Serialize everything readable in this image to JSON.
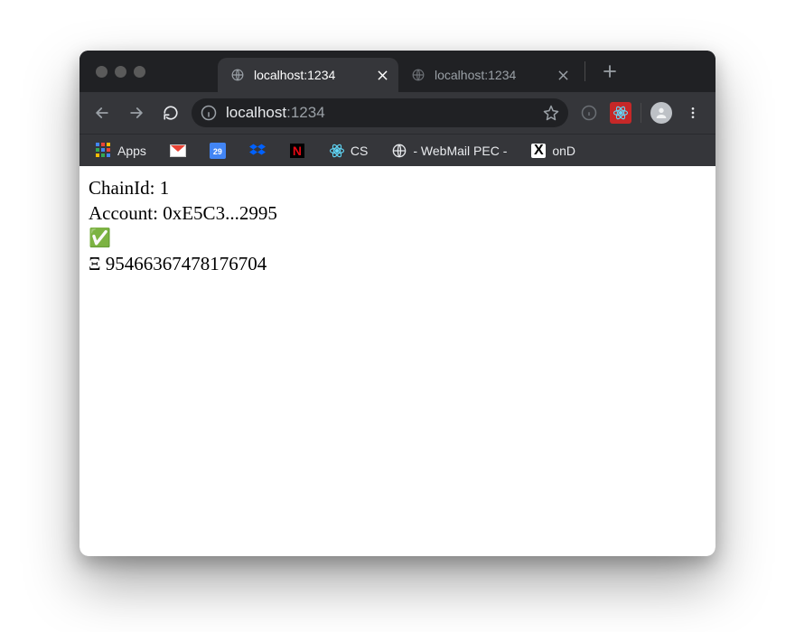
{
  "tabs": {
    "items": [
      {
        "title": "localhost:1234",
        "active": true
      },
      {
        "title": "localhost:1234",
        "active": false
      }
    ]
  },
  "omnibox": {
    "host": "localhost",
    "port": ":1234"
  },
  "bookmarks": {
    "items": [
      {
        "label": "Apps",
        "icon": "apps-grid-icon"
      },
      {
        "label": "",
        "icon": "gmail-icon"
      },
      {
        "label": "",
        "icon": "calendar-icon",
        "badge": "29"
      },
      {
        "label": "",
        "icon": "dropbox-icon"
      },
      {
        "label": "",
        "icon": "netflix-icon"
      },
      {
        "label": "CS",
        "icon": "react-icon"
      },
      {
        "label": "- WebMail PEC -",
        "icon": "globe-icon"
      },
      {
        "label": "onD",
        "icon": "x-icon"
      }
    ]
  },
  "page": {
    "chain_label": "ChainId:",
    "chain_value": "1",
    "account_label": "Account:",
    "account_value": "0xE5C3...2995",
    "status_emoji": "✅",
    "balance_symbol": "Ξ",
    "balance_value": "95466367478176704"
  }
}
